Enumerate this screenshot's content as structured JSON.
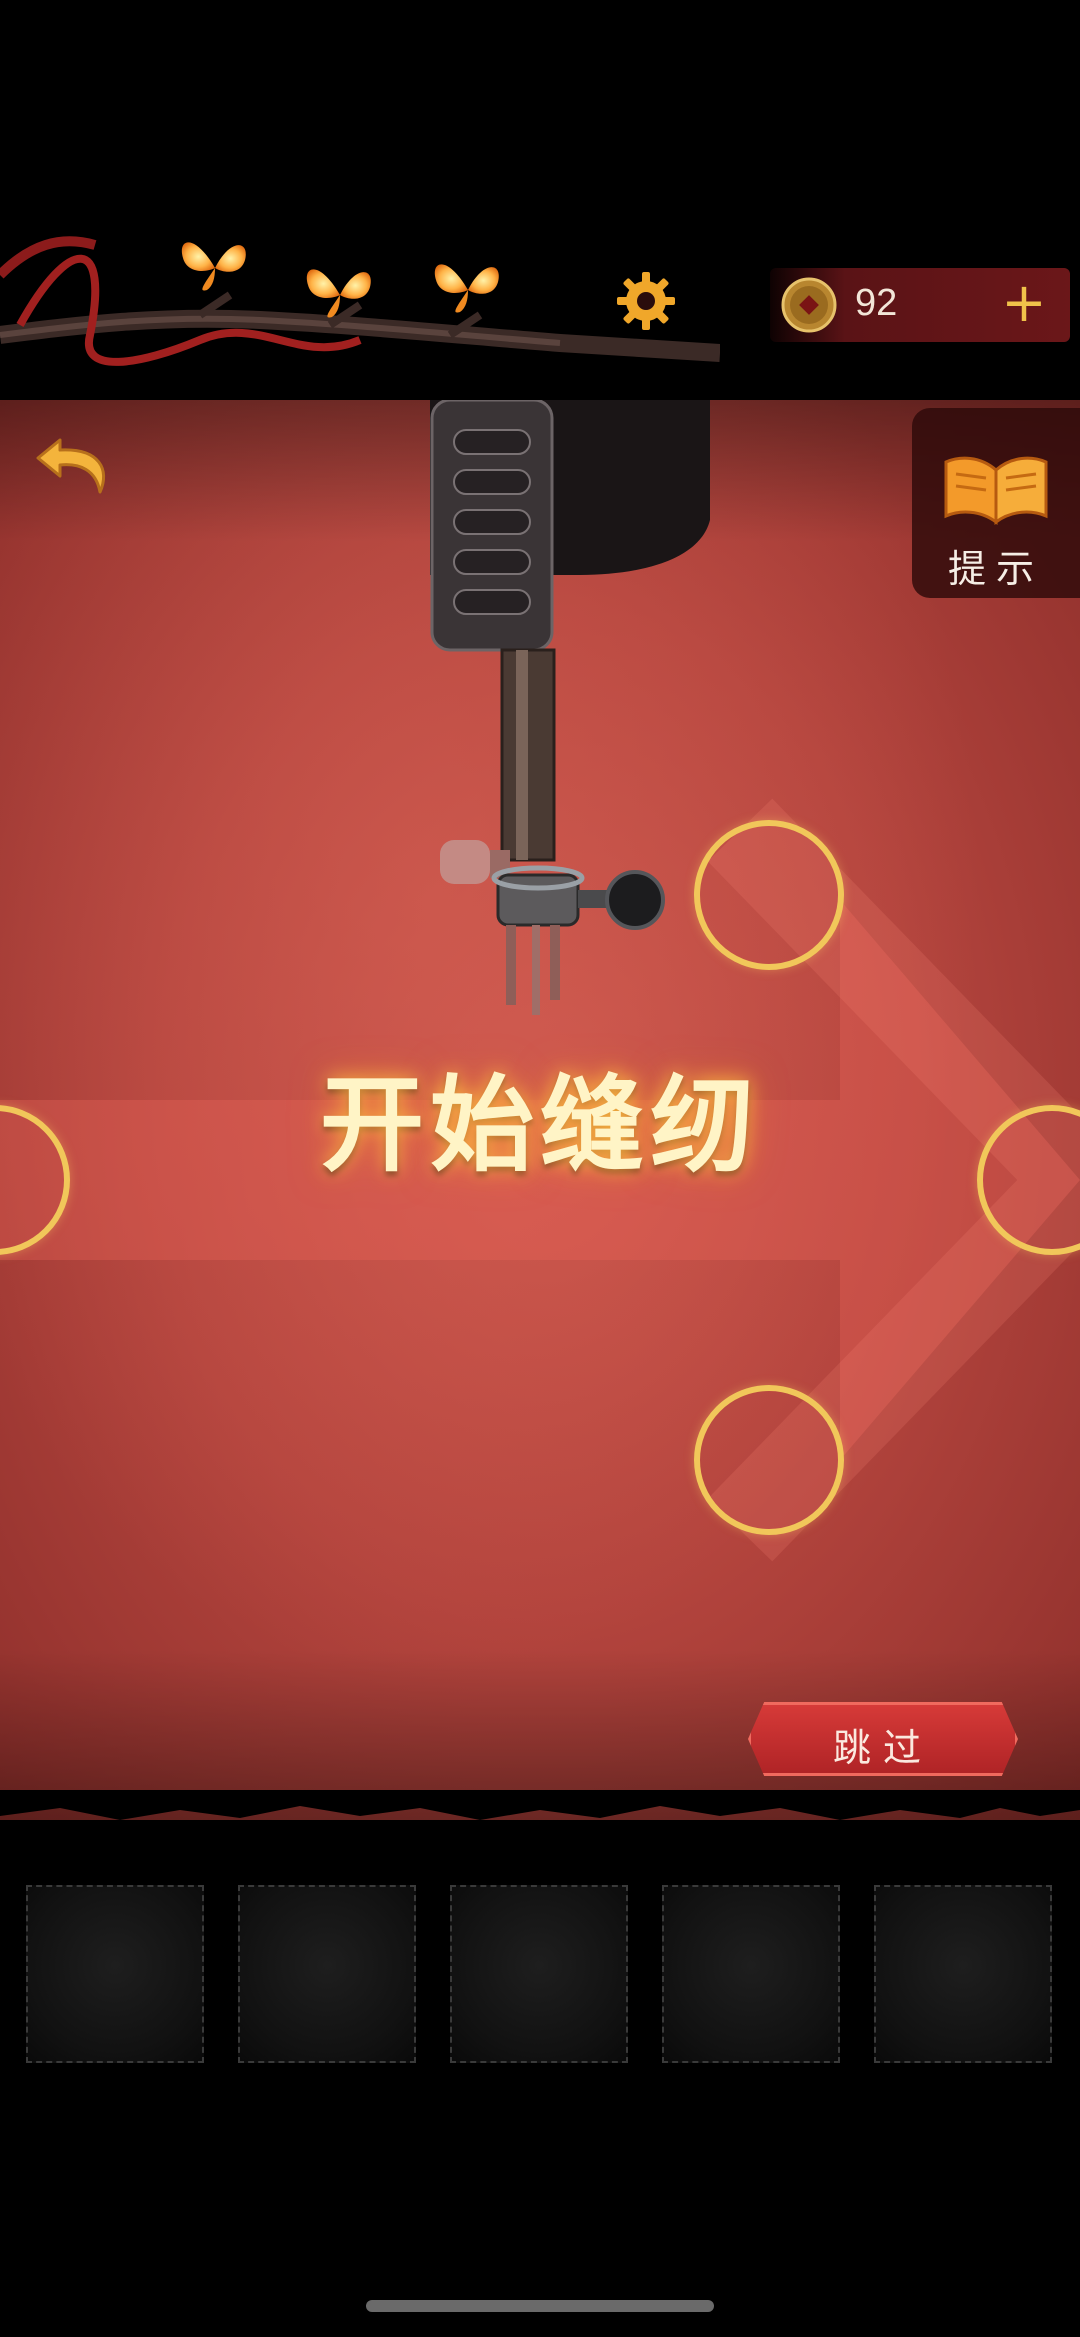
{
  "header": {
    "lives": [
      "butterfly",
      "butterfly",
      "butterfly"
    ],
    "settings_icon": "gear-icon",
    "coins": {
      "icon": "coin-icon",
      "value": "92",
      "add_label": "+"
    }
  },
  "side": {
    "back_icon": "undo-arrow-icon",
    "hint": {
      "icon": "open-book-icon",
      "label": "提示"
    }
  },
  "puzzle": {
    "title": "开始缝纫",
    "targets": [
      "top",
      "left",
      "right",
      "bottom"
    ]
  },
  "skip": {
    "label": "跳过"
  },
  "inventory": {
    "slots": [
      "",
      "",
      "",
      "",
      ""
    ]
  },
  "colors": {
    "accent_gold": "#f1c75a",
    "cloth_red": "#b3443d",
    "skip_red": "#d63a38",
    "glow_orange": "#ffb347"
  }
}
